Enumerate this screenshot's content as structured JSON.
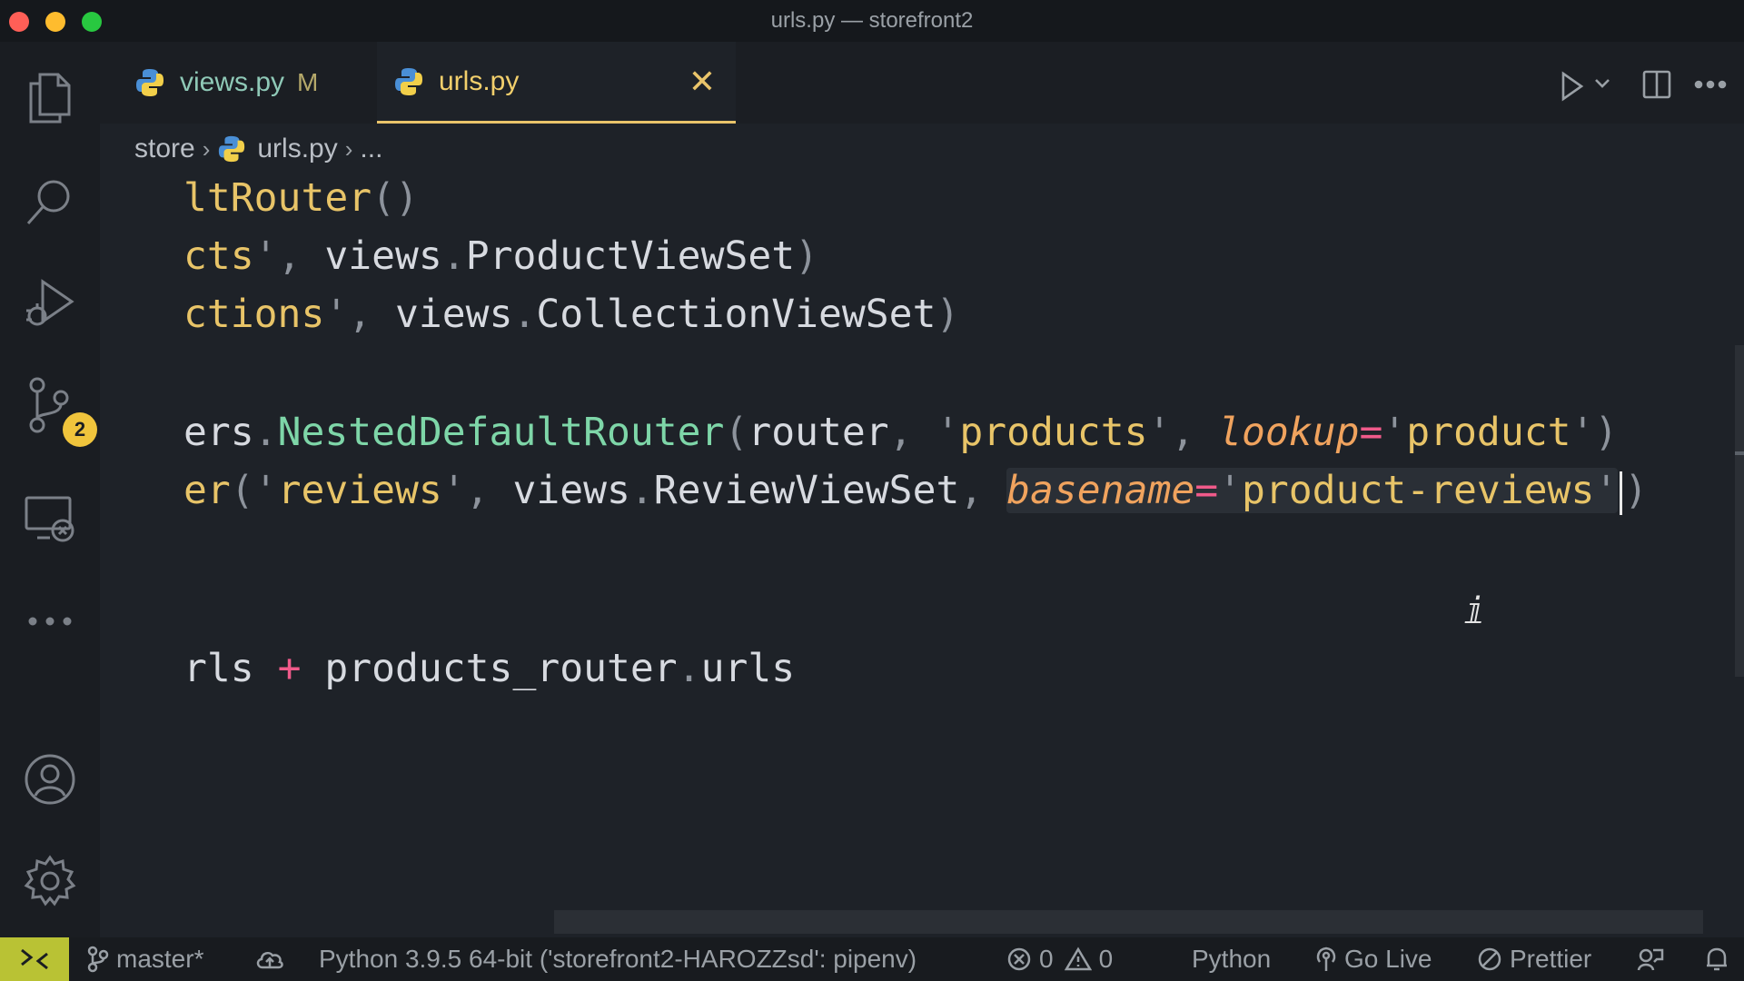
{
  "window": {
    "title": "urls.py — storefront2"
  },
  "activity_bar": {
    "items": [
      "explorer-icon",
      "search-icon",
      "run-debug-icon",
      "source-control-icon",
      "remote-explorer-icon",
      "more-icon",
      "accounts-icon",
      "settings-gear-icon"
    ],
    "source_control_badge": "2"
  },
  "tabs": [
    {
      "label": "views.py",
      "status": "M",
      "active": false
    },
    {
      "label": "urls.py",
      "close": "✕",
      "active": true
    }
  ],
  "breadcrumb": {
    "folder": "store",
    "file": "urls.py",
    "more": "..."
  },
  "code": {
    "l1": {
      "a": "ltRouter",
      "b": "()"
    },
    "l2": {
      "a": "cts",
      "b": "'",
      "c": ", ",
      "d": "views",
      "e": ".",
      "f": "ProductViewSet",
      "g": ")"
    },
    "l3": {
      "a": "ctions",
      "b": "'",
      "c": ", ",
      "d": "views",
      "e": ".",
      "f": "CollectionViewSet",
      "g": ")"
    },
    "l4": {
      "a": "ers",
      "b": ".",
      "c": "NestedDefaultRouter",
      "d": "(",
      "e": "router",
      "f": ", ",
      "g": "'",
      "h": "products",
      "i": "'",
      "j": ", ",
      "k": "lookup",
      "l": "=",
      "m": "'",
      "n": "product",
      "o": "'",
      "p": ")"
    },
    "l5": {
      "a": "er",
      "b": "(",
      "c": "'",
      "d": "reviews",
      "e": "'",
      "f": ", ",
      "g": "views",
      "h": ".",
      "i": "ReviewViewSet",
      "j": ", ",
      "k": "basename",
      "l": "=",
      "m": "'",
      "n": "product-reviews",
      "o": "'",
      "p": ")"
    },
    "l6": {
      "a": "rls ",
      "b": "+",
      "c": " products_router",
      "d": ".",
      "e": "urls"
    }
  },
  "status_bar": {
    "branch": "master*",
    "interpreter": "Python 3.9.5 64-bit ('storefront2-HAROZZsd': pipenv)",
    "errors": "0",
    "warnings": "0",
    "language": "Python",
    "go_live": "Go Live",
    "prettier": "Prettier"
  }
}
